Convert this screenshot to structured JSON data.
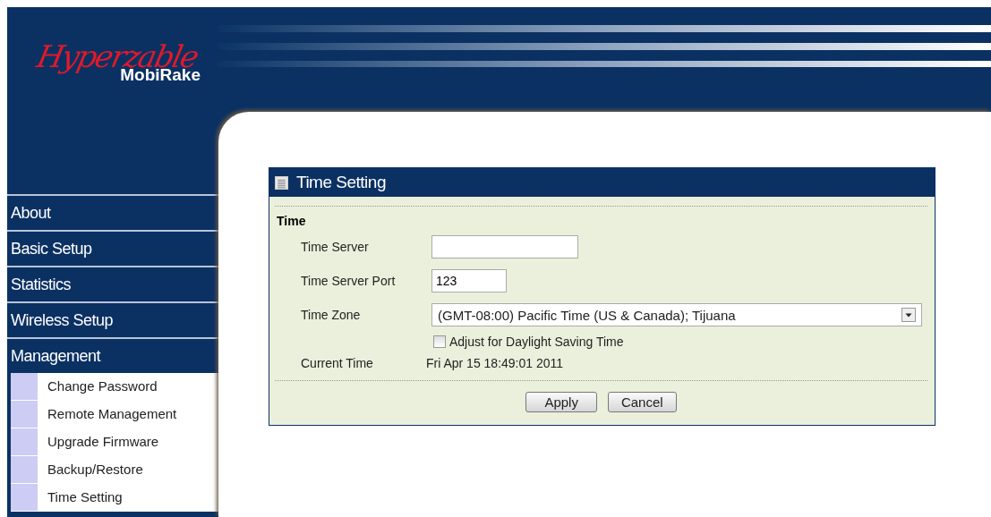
{
  "logo": {
    "script": "Hyperzable",
    "product": "MobiRake"
  },
  "menu": [
    {
      "label": "About"
    },
    {
      "label": "Basic Setup"
    },
    {
      "label": "Statistics"
    },
    {
      "label": "Wireless Setup"
    },
    {
      "label": "Management",
      "children": [
        {
          "label": "Change Password"
        },
        {
          "label": "Remote Management"
        },
        {
          "label": "Upgrade Firmware"
        },
        {
          "label": "Backup/Restore"
        },
        {
          "label": "Time Setting"
        }
      ]
    }
  ],
  "panel": {
    "title": "Time Setting",
    "section": "Time",
    "fields": [
      {
        "kind": "text",
        "label": "Time Server"
      },
      {
        "kind": "text",
        "label": "Time Server Port",
        "value": "123"
      },
      {
        "kind": "select",
        "label": "Time Zone",
        "value": "(GMT-08:00) Pacific Time (US & Canada); Tijuana"
      },
      {
        "kind": "checkbox",
        "label": "Adjust for Daylight Saving Time",
        "checked": false
      },
      {
        "kind": "info",
        "label": "Current Time",
        "value": "Fri Apr 15 18:49:01 2011"
      }
    ],
    "buttons": [
      "Apply",
      "Cancel"
    ]
  }
}
